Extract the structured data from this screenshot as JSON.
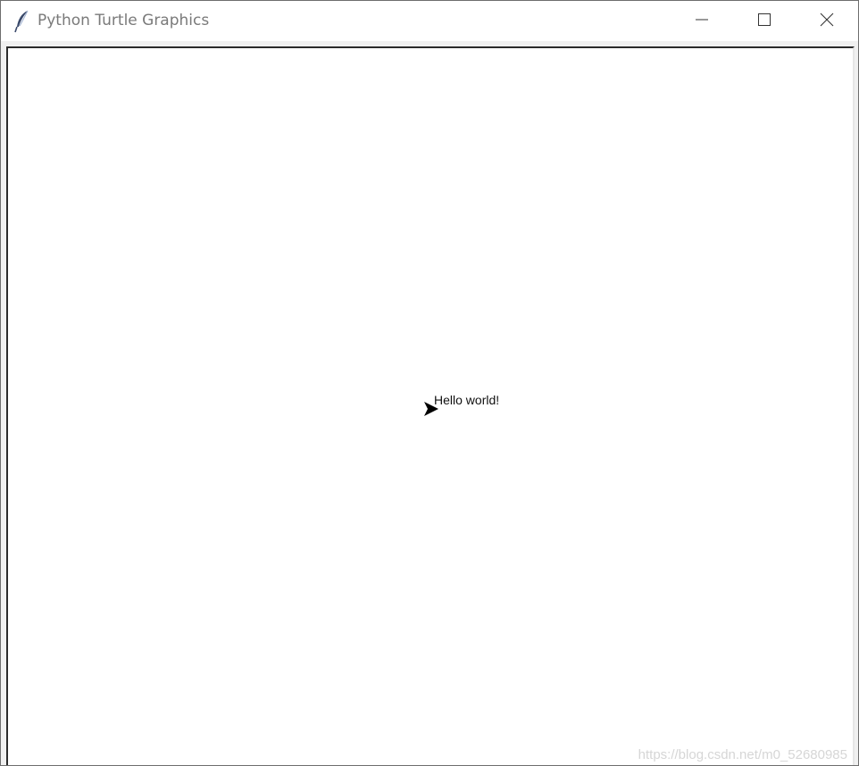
{
  "window": {
    "title": "Python Turtle Graphics",
    "icon": "feather-icon",
    "controls": {
      "minimize": "minimize-icon",
      "maximize": "maximize-icon",
      "close": "close-icon"
    }
  },
  "canvas": {
    "text": "Hello world!",
    "turtle_shape": "classic-arrow",
    "turtle_color": "#000000",
    "background": "#ffffff"
  },
  "watermark": {
    "text": "https://blog.csdn.net/m0_52680985"
  }
}
